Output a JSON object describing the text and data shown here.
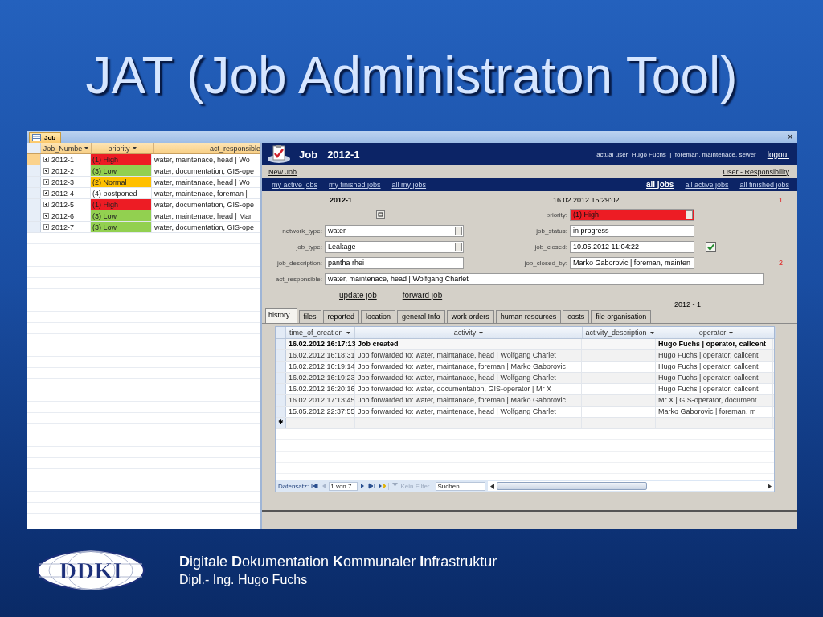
{
  "slide_title": "JAT (Job Administraton Tool)",
  "document_tab": {
    "label": "Job",
    "close": "×"
  },
  "job_list": {
    "columns": [
      "Job_Numbe",
      "priority",
      "act_responsible"
    ],
    "rows": [
      {
        "job_number": "2012-1",
        "priority": "(1) High",
        "color": "#ed1c24",
        "act_responsible": "water, maintenace, head | Wo",
        "selected": true
      },
      {
        "job_number": "2012-2",
        "priority": "(3) Low",
        "color": "#92d050",
        "act_responsible": "water, documentation, GIS-ope",
        "selected": false
      },
      {
        "job_number": "2012-3",
        "priority": "(2) Normal",
        "color": "#ffc000",
        "act_responsible": "water, maintanace, head | Wo",
        "selected": false
      },
      {
        "job_number": "2012-4",
        "priority": "(4) postponed",
        "color": "#ffffff",
        "act_responsible": "water, maintenace, foreman |",
        "selected": false
      },
      {
        "job_number": "2012-5",
        "priority": "(1) High",
        "color": "#ed1c24",
        "act_responsible": "water, documentation, GIS-ope",
        "selected": false
      },
      {
        "job_number": "2012-6",
        "priority": "(3) Low",
        "color": "#92d050",
        "act_responsible": "water, maintenace, head | Mar",
        "selected": false
      },
      {
        "job_number": "2012-7",
        "priority": "(3) Low",
        "color": "#92d050",
        "act_responsible": "water, documentation, GIS-ope",
        "selected": false
      }
    ]
  },
  "form": {
    "header": {
      "title": "Job",
      "job_number": "2012-1",
      "user_info": "actual user: Hugo Fuchs  |  foreman, maintenace, sewer",
      "logout": "logout"
    },
    "toolbar": {
      "new_job": "New Job",
      "responsibility": "User - Responsibility"
    },
    "nav_links_left": [
      {
        "label": "my active jobs",
        "selected": false
      },
      {
        "label": "my finished jobs",
        "selected": false
      },
      {
        "label": "all my jobs",
        "selected": false
      }
    ],
    "nav_links_right": [
      {
        "label": "all jobs",
        "selected": true
      },
      {
        "label": "all active jobs",
        "selected": false
      },
      {
        "label": "all finished jobs",
        "selected": false
      }
    ],
    "job_number": "2012-1",
    "created": "16.02.2012 15:29:02",
    "marker_1": "1",
    "rows": [
      {
        "right": {
          "label": "priority:",
          "value": "(1) High",
          "kind": "dropdown",
          "color": "#ed1c24"
        }
      },
      {
        "left": {
          "label": "network_type:",
          "value": "water",
          "kind": "dropdown"
        },
        "right": {
          "label": "job_status:",
          "value": "in progress",
          "kind": "text"
        }
      },
      {
        "left": {
          "label": "job_type:",
          "value": "Leakage",
          "kind": "dropdown"
        },
        "right": {
          "label": "job_closed:",
          "value": "10.05.2012 11:04:22",
          "kind": "text"
        },
        "checked": true
      },
      {
        "left": {
          "label": "job_description:",
          "value": "pantha rhei",
          "kind": "text"
        },
        "right": {
          "label": "job_closed_by:",
          "value": "Marko Gaborovic | foreman, mainten",
          "kind": "text"
        },
        "marker": "2"
      }
    ],
    "act_responsible": {
      "label": "act_responsible:",
      "value": "water, maintenace, head | Wolfgang Charlet"
    },
    "buttons": [
      "update job",
      "forward job"
    ],
    "job_code": "2012  - 1"
  },
  "tabs": [
    {
      "label": "history",
      "selected": true
    },
    {
      "label": "files",
      "selected": false
    },
    {
      "label": "reported",
      "selected": false
    },
    {
      "label": "location",
      "selected": false
    },
    {
      "label": "general Info",
      "selected": false
    },
    {
      "label": "work orders",
      "selected": false
    },
    {
      "label": "human resources",
      "selected": false
    },
    {
      "label": "costs",
      "selected": false
    },
    {
      "label": "file organisation",
      "selected": false
    }
  ],
  "history": {
    "columns": [
      "time_of_creation",
      "activity",
      "activity_description",
      "operator"
    ],
    "rows": [
      {
        "time": "16.02.2012 16:17:13",
        "activity": "Job created",
        "operator": "Hugo Fuchs | operator, callcent",
        "selected": true
      },
      {
        "time": "16.02.2012 16:18:31",
        "activity": "Job forwarded to: water, maintanace, head | Wolfgang Charlet",
        "operator": "Hugo Fuchs | operator, callcent",
        "selected": false
      },
      {
        "time": "16.02.2012 16:19:14",
        "activity": "Job forwarded to: water, maintanace, foreman | Marko Gaborovic",
        "operator": "Hugo Fuchs | operator, callcent",
        "selected": false
      },
      {
        "time": "16.02.2012 16:19:23",
        "activity": "Job forwarded to: water, maintanace, head | Wolfgang Charlet",
        "operator": "Hugo Fuchs | operator, callcent",
        "selected": false
      },
      {
        "time": "16.02.2012 16:20:16",
        "activity": "Job forwarded to: water, documentation, GIS-operator | Mr X",
        "operator": "Hugo Fuchs | operator, callcent",
        "selected": false
      },
      {
        "time": "16.02.2012 17:13:45",
        "activity": "Job forwarded to: water, maintanace, foreman | Marko Gaborovic",
        "operator": "Mr X | GIS-operator, document",
        "selected": false
      },
      {
        "time": "15.05.2012 22:37:55",
        "activity": "Job forwarded to: water, maintenace, head | Wolfgang Charlet",
        "operator": "Marko Gaborovic | foreman, m",
        "selected": false
      }
    ],
    "new_row_marker": "✱",
    "navigator": {
      "label": "Datensatz:",
      "position": "1 von 7",
      "filter": {
        "label": "Kein Filter",
        "disabled": true
      },
      "search": "Suchen"
    }
  },
  "footer": {
    "logo": "DDKI",
    "line_1": "**D**igitale **D**okumentation **K**ommunaler **I**nfrastruktur",
    "line_2": "Dipl.- Ing. Hugo Fuchs"
  }
}
